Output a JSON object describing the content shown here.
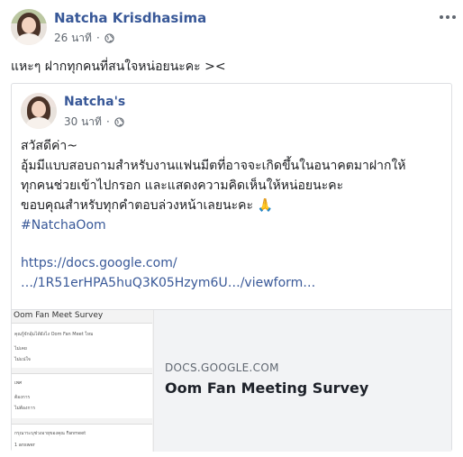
{
  "post": {
    "author": "Natcha Krisdhasima",
    "timestamp": "26 นาที",
    "separator": "·",
    "privacy_icon": "globe-icon",
    "text": "แหะๆ ฝากทุกคนที่สนใจหน่อยนะคะ ><"
  },
  "shared_post": {
    "author": "Natcha's",
    "timestamp": "30 นาที",
    "separator": "·",
    "privacy_icon": "globe-icon",
    "lines": [
      "สวัสดีค่า~",
      "อุ้มมีแบบสอบถามสำหรับงานแฟนมีตที่อาจจะเกิดขึ้นในอนาคตมาฝากให้",
      "ทุกคนช่วยเข้าไปกรอก และแสดงความคิดเห็นให้หน่อยนะคะ",
      "ขอบคุณสำหรับทุกคำตอบล่วงหน้าเลยนะคะ 🙏"
    ],
    "hashtag": "#NatchaOom",
    "link_line1": "https://docs.google.com/",
    "link_line2": "…/1R51erHPA5huQ3K05Hzym6U…/viewform…"
  },
  "link_card": {
    "domain": "DOCS.GOOGLE.COM",
    "title": "Oom Fan Meeting Survey",
    "thumb_title": "Oom Fan Meet Survey",
    "thumb_lines": [
      "คุณรู้จักอุ้มได้ยังไง Oom Fan Meet ไหม",
      "ไม่เคย",
      "ไม่แน่ใจ",
      "เพศ",
      "ต้องการ",
      "ไม่ต้องการ",
      "กรุณาระบุช่วงอายุของคุณ Fanmeet",
      "1 answer"
    ]
  },
  "colors": {
    "link": "#385898",
    "text": "#1c1e21",
    "meta": "#606770",
    "card_bg": "#f2f3f5"
  }
}
